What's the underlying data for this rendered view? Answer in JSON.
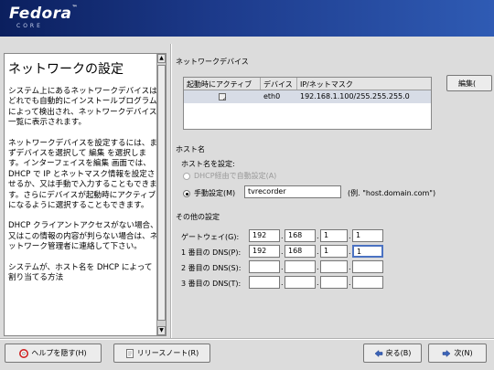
{
  "brand": {
    "logo": "Fedora",
    "sub": "CORE"
  },
  "help": {
    "title": "ネットワークの設定",
    "paragraphs": [
      "システム上にあるネットワークデバイスはどれでも自動的にインストールプログラムによって検出され、ネットワークデバイス 一覧に表示されます。",
      "ネットワークデバイスを設定するには、まずデバイスを選択して 編集 を選択します。インターフェイスを編集 画面では、DHCP で IP とネットマスク情報を設定させるか、又は手動で入力することもできます。さらにデバイスが起動時にアクティブになるように選択することもできます。",
      "DHCP クライアントアクセスがない場合、又はこの情報の内容が判らない場合は、ネットワーク管理者に連絡して下さい。",
      "システムが、ホスト名を DHCP によって割り当てる方法"
    ]
  },
  "devices": {
    "section_label": "ネットワークデバイス",
    "columns": [
      "起動時にアクティブ",
      "デバイス",
      "IP/ネットマスク"
    ],
    "rows": [
      {
        "active_mark": "✓",
        "device": "eth0",
        "ip": "192.168.1.100/255.255.255.0"
      }
    ],
    "edit_label": "編集("
  },
  "hostname": {
    "section_label": "ホスト名",
    "set_label": "ホスト名を設定:",
    "dhcp_label": "DHCP経由で自動設定(A)",
    "manual_label": "手動設定(M)",
    "value": "tvrecorder",
    "example": "(例. \"host.domain.com\")"
  },
  "other": {
    "section_label": "その他の設定",
    "fields": [
      {
        "label": "ゲートウェイ(G):",
        "octets": [
          "192",
          "168",
          "1",
          "1"
        ]
      },
      {
        "label": "1 番目の DNS(P):",
        "octets": [
          "192",
          "168",
          "1",
          "1"
        ]
      },
      {
        "label": "2 番目の DNS(S):",
        "octets": [
          "",
          "",
          "",
          ""
        ]
      },
      {
        "label": "3 番目の DNS(T):",
        "octets": [
          "",
          "",
          "",
          ""
        ]
      }
    ]
  },
  "footer": {
    "hide_help": "ヘルプを隠す(H)",
    "release_notes": "リリースノート(R)",
    "back": "戻る(B)",
    "next": "次(N)"
  }
}
